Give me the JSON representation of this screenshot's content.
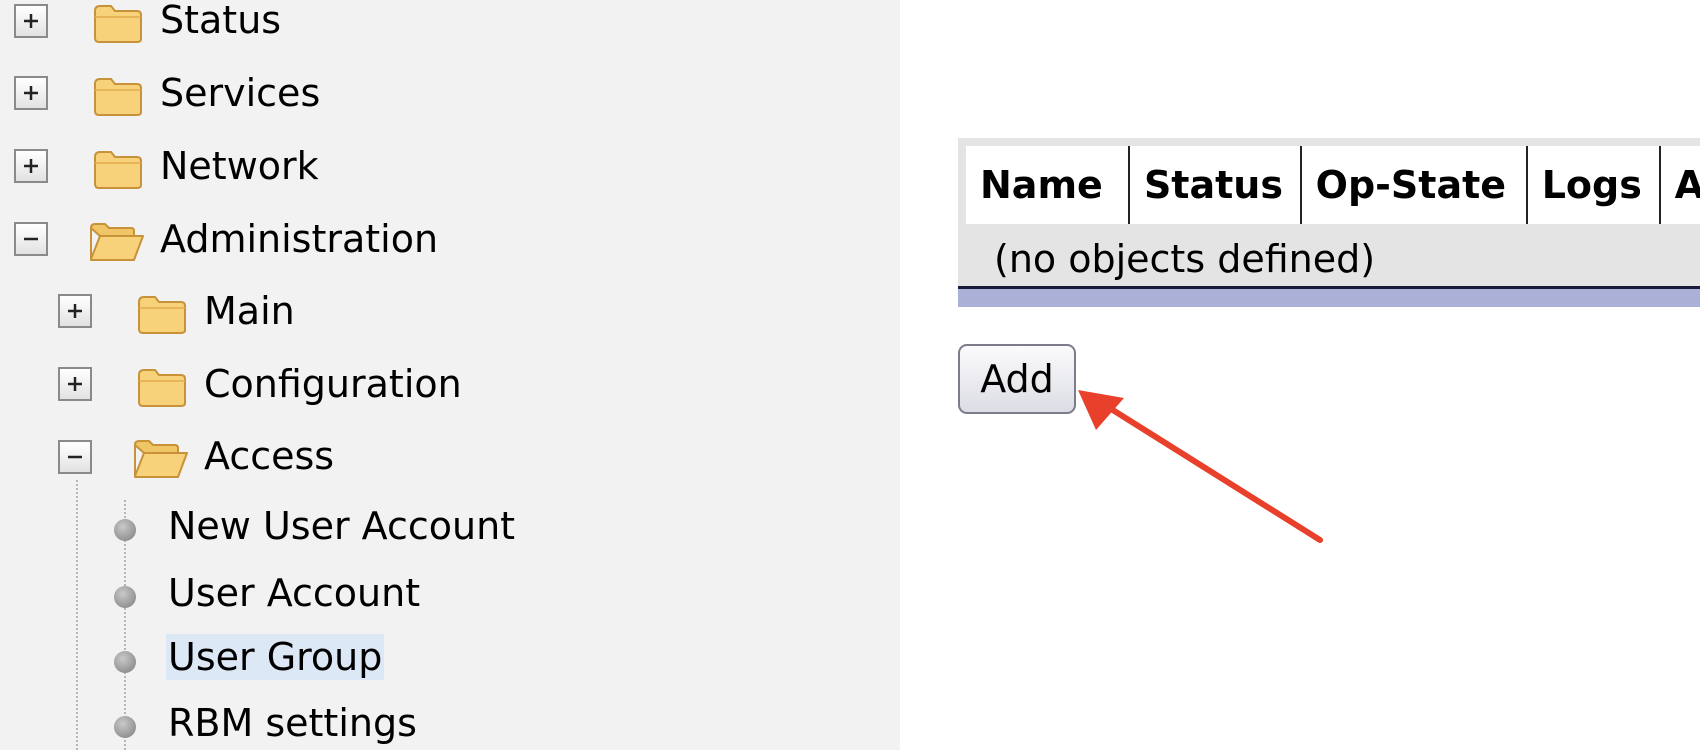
{
  "tree": {
    "nodes": [
      {
        "label": "Status",
        "state": "collapsed"
      },
      {
        "label": "Services",
        "state": "collapsed"
      },
      {
        "label": "Network",
        "state": "collapsed"
      },
      {
        "label": "Administration",
        "state": "expanded"
      },
      {
        "label": "Main",
        "state": "collapsed"
      },
      {
        "label": "Configuration",
        "state": "collapsed"
      },
      {
        "label": "Access",
        "state": "expanded"
      }
    ],
    "leaves": [
      {
        "label": "New User Account"
      },
      {
        "label": "User Account"
      },
      {
        "label": "User Group",
        "selected": true
      },
      {
        "label": "RBM settings"
      }
    ]
  },
  "table": {
    "columns": [
      "Name",
      "Status",
      "Op-State",
      "Logs",
      "A"
    ],
    "empty_message": "(no objects defined)"
  },
  "actions": {
    "add_label": "Add"
  },
  "annotation": {
    "arrow_color": "#e8402a"
  },
  "colors": {
    "sidebar_bg": "#f2f2f2",
    "selected_bg": "#dde8f6",
    "table_footer": "#aab0d6",
    "folder": "#f7d27a"
  }
}
